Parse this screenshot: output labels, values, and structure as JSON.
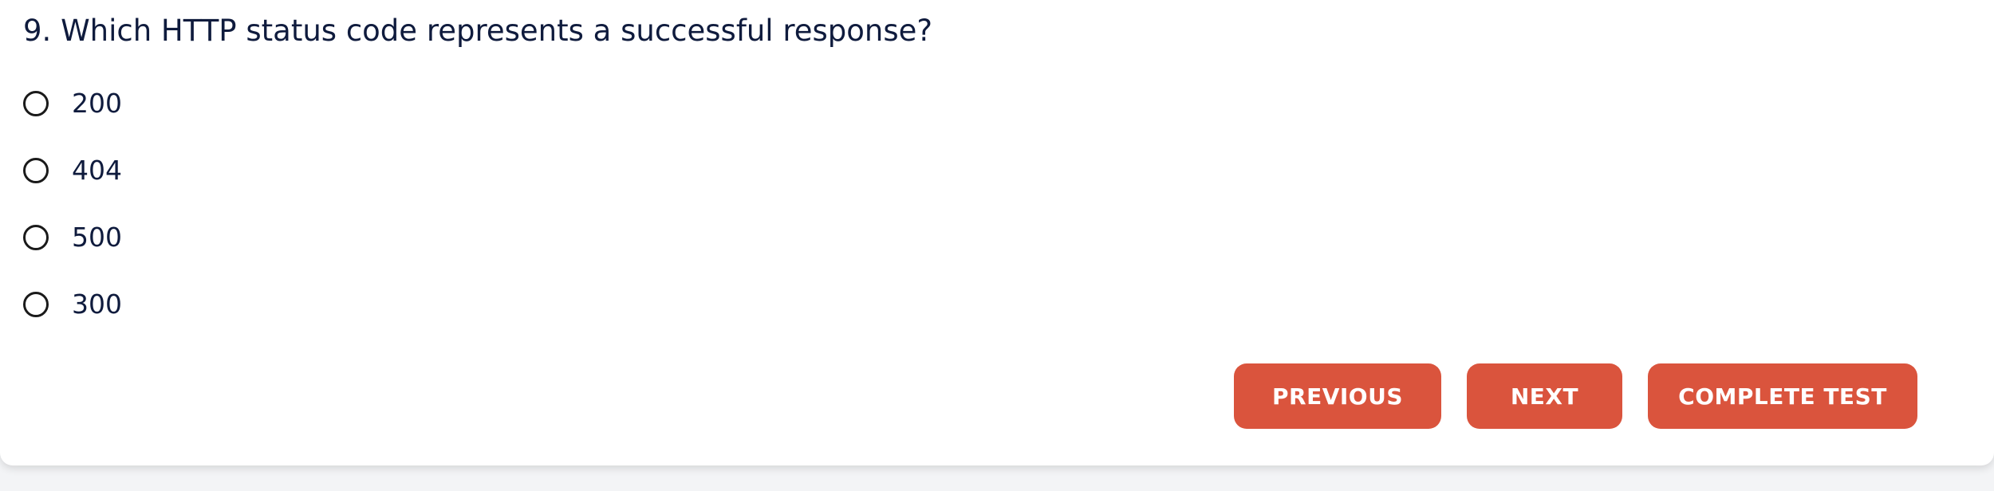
{
  "question": {
    "text": "9. Which HTTP status code represents a successful response?"
  },
  "options": [
    {
      "label": "200",
      "selected": false
    },
    {
      "label": "404",
      "selected": false
    },
    {
      "label": "500",
      "selected": false
    },
    {
      "label": "300",
      "selected": false
    }
  ],
  "buttons": {
    "previous": "PREVIOUS",
    "next": "NEXT",
    "complete": "COMPLETE TEST"
  },
  "colors": {
    "accent": "#da543d",
    "text": "#0f1b3d",
    "background": "#ffffff"
  }
}
